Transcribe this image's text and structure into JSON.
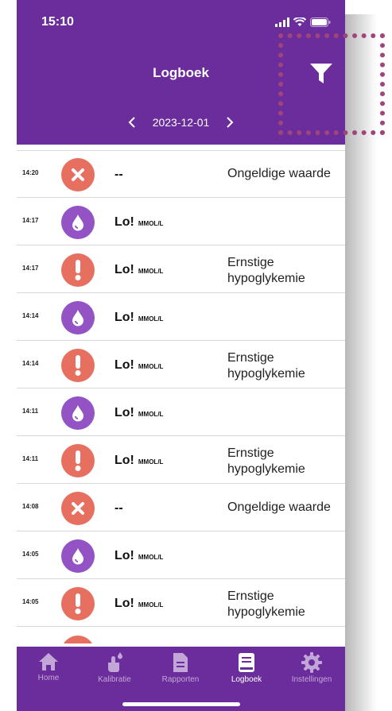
{
  "status": {
    "time": "15:10"
  },
  "header": {
    "title": "Logboek",
    "date": "2023-12-01"
  },
  "units": {
    "mmol": "MMOL/L"
  },
  "entries": [
    {
      "time": "14:20",
      "icon": "cross-icon",
      "value": "--",
      "unit": "",
      "desc1": "Ongeldige waarde",
      "desc2": ""
    },
    {
      "time": "14:17",
      "icon": "drop-icon",
      "value": "Lo!",
      "unit": "MMOL/L",
      "desc1": "",
      "desc2": ""
    },
    {
      "time": "14:17",
      "icon": "exclamation-icon",
      "value": "Lo!",
      "unit": "MMOL/L",
      "desc1": "Ernstige",
      "desc2": "hypoglykemie"
    },
    {
      "time": "14:14",
      "icon": "drop-icon",
      "value": "Lo!",
      "unit": "MMOL/L",
      "desc1": "",
      "desc2": ""
    },
    {
      "time": "14:14",
      "icon": "exclamation-icon",
      "value": "Lo!",
      "unit": "MMOL/L",
      "desc1": "Ernstige",
      "desc2": "hypoglykemie"
    },
    {
      "time": "14:11",
      "icon": "drop-icon",
      "value": "Lo!",
      "unit": "MMOL/L",
      "desc1": "",
      "desc2": ""
    },
    {
      "time": "14:11",
      "icon": "exclamation-icon",
      "value": "Lo!",
      "unit": "MMOL/L",
      "desc1": "Ernstige",
      "desc2": "hypoglykemie"
    },
    {
      "time": "14:08",
      "icon": "cross-icon",
      "value": "--",
      "unit": "",
      "desc1": "Ongeldige waarde",
      "desc2": ""
    },
    {
      "time": "14:05",
      "icon": "drop-icon",
      "value": "Lo!",
      "unit": "MMOL/L",
      "desc1": "",
      "desc2": ""
    },
    {
      "time": "14:05",
      "icon": "exclamation-icon",
      "value": "Lo!",
      "unit": "MMOL/L",
      "desc1": "Ernstige",
      "desc2": "hypoglykemie"
    }
  ],
  "tabs": [
    {
      "label": "Home",
      "icon": "home-icon"
    },
    {
      "label": "Kalibratie",
      "icon": "finger-drop-icon"
    },
    {
      "label": "Rapporten",
      "icon": "document-icon"
    },
    {
      "label": "Logboek",
      "icon": "book-icon"
    },
    {
      "label": "Instellingen",
      "icon": "gear-icon"
    }
  ],
  "colors": {
    "header": "#6b2d9b",
    "red": "#e76f5f",
    "purple": "#9353c4",
    "highlight": "#a0457a"
  }
}
